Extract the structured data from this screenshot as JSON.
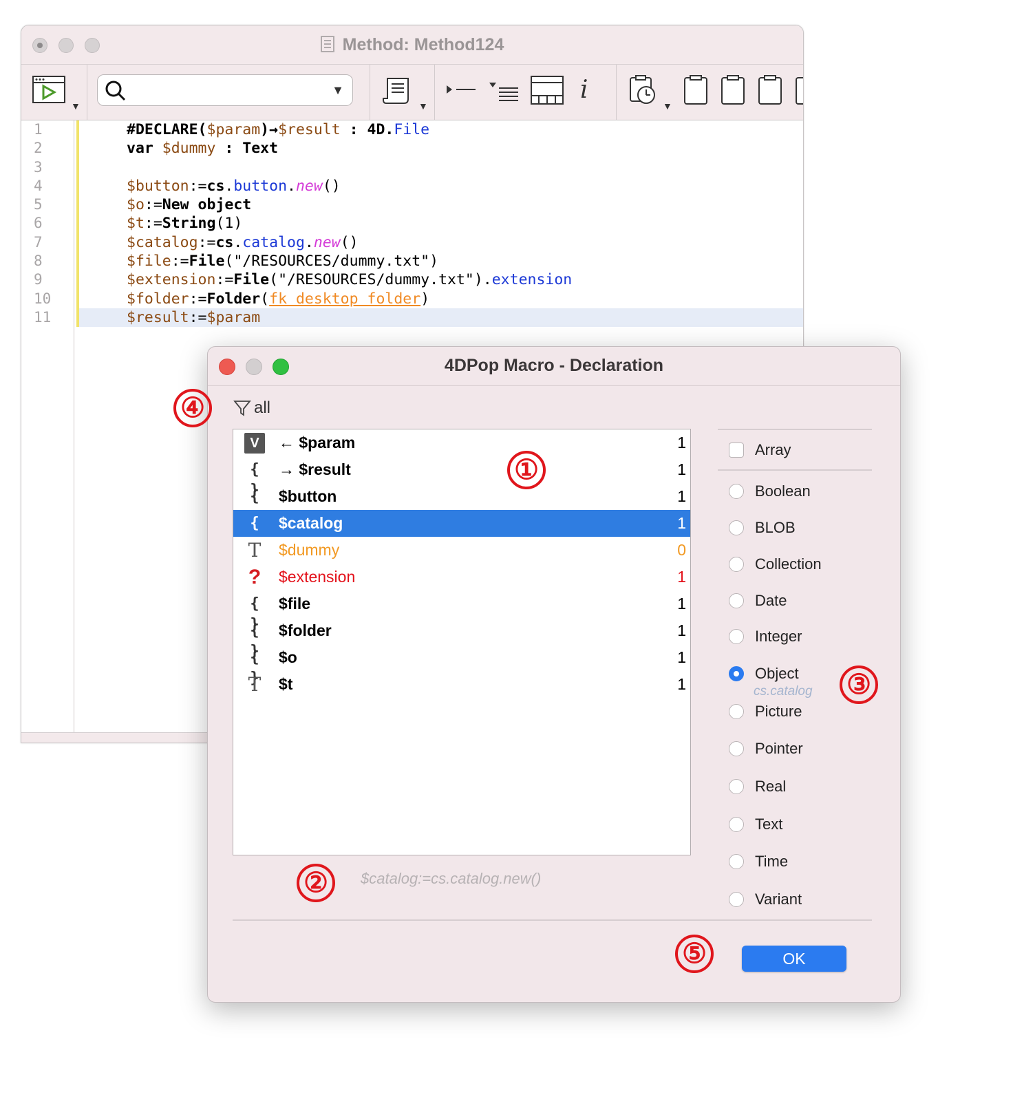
{
  "editor": {
    "title": "Method: Method124",
    "line_numbers": [
      "1",
      "2",
      "3",
      "4",
      "5",
      "6",
      "7",
      "8",
      "9",
      "10",
      "11"
    ]
  },
  "search": {
    "value": "",
    "placeholder": ""
  },
  "dialog": {
    "title": "4DPop Macro - Declaration",
    "filter_label": "all",
    "variables": [
      {
        "icon": "V",
        "name": "← $param",
        "count": "1"
      },
      {
        "icon": "{ }",
        "name": "→ $result",
        "count": "1"
      },
      {
        "icon": "{ }",
        "name": "$button",
        "count": "1"
      },
      {
        "icon": "{ }",
        "name": "$catalog",
        "count": "1"
      },
      {
        "icon": "T",
        "name": "$dummy",
        "count": "0"
      },
      {
        "icon": "?",
        "name": "$extension",
        "count": "1"
      },
      {
        "icon": "{ }",
        "name": "$file",
        "count": "1"
      },
      {
        "icon": "{ }",
        "name": "$folder",
        "count": "1"
      },
      {
        "icon": "{ }",
        "name": "$o",
        "count": "1"
      },
      {
        "icon": "T",
        "name": "$t",
        "count": "1"
      }
    ],
    "selected_variable": "$catalog",
    "preview_code": "$catalog:=cs.catalog.new()",
    "array_label": "Array",
    "types": [
      "Boolean",
      "BLOB",
      "Collection",
      "Date",
      "Integer",
      "Object",
      "Picture",
      "Pointer",
      "Real",
      "Text",
      "Time",
      "Variant"
    ],
    "selected_type": "Object",
    "object_class_hint": "cs.catalog",
    "ok_label": "OK"
  },
  "callouts": [
    "①",
    "②",
    "③",
    "④",
    "⑤"
  ],
  "colors": {
    "selection": "#2f7de1",
    "accent_button": "#2b7bf0",
    "callout_red": "#e0161c",
    "unused_var": "#f29a24",
    "undefined_var": "#e3121b"
  }
}
